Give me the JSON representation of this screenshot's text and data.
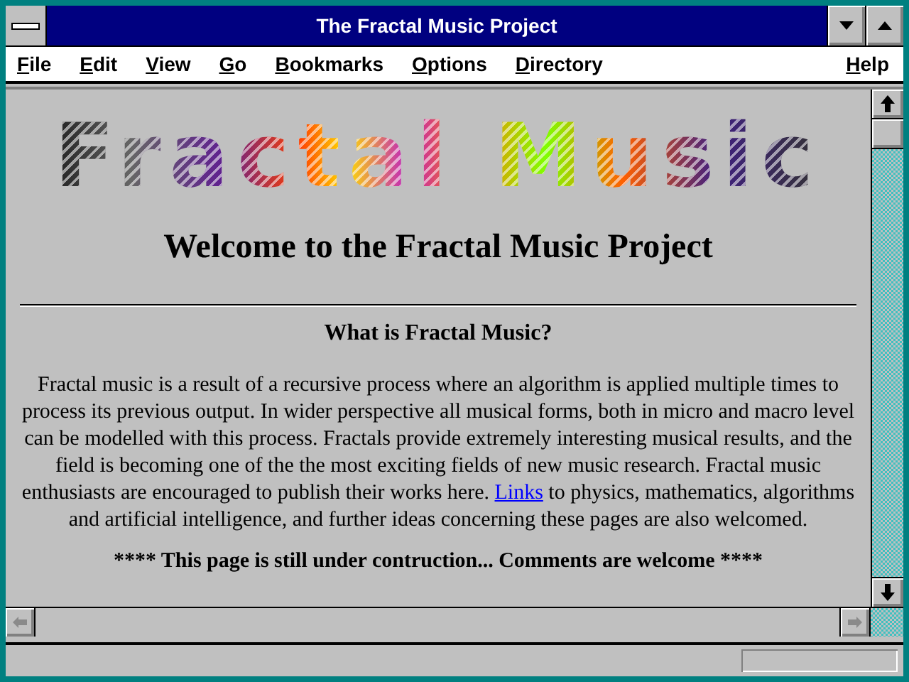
{
  "window": {
    "title": "The Fractal Music Project"
  },
  "menu": [
    {
      "label": "File"
    },
    {
      "label": "Edit"
    },
    {
      "label": "View"
    },
    {
      "label": "Go"
    },
    {
      "label": "Bookmarks"
    },
    {
      "label": "Options"
    },
    {
      "label": "Directory"
    },
    {
      "label": "Help"
    }
  ],
  "page": {
    "logo": "Fractal Music",
    "heading": "Welcome to the Fractal Music Project",
    "subheading": "What is Fractal Music?",
    "paragraph_before_link": "Fractal music is a result of a recursive process where an algorithm is applied multiple times to process its previous output. In wider perspective all musical forms, both in micro and macro level can be modelled with this process. Fractals provide extremely interesting musical results, and the field is becoming one of the the most exciting fields of new music research. Fractal music enthusiasts are encouraged to publish their works here.",
    "link": "Links",
    "paragraph_after_link": "to physics, mathematics, algorithms and artificial intelligence, and further ideas concerning these pages are also welcomed.",
    "notice": "**** This page is still under contruction... Comments are welcome ****"
  }
}
